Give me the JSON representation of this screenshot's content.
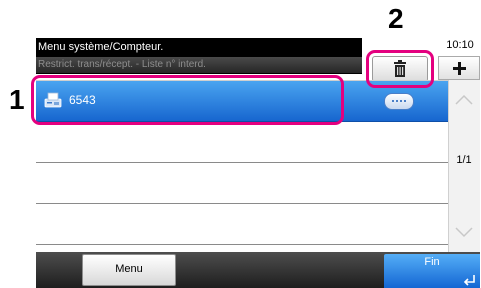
{
  "header": {
    "breadcrumb_line1": "Menu système/Compteur.",
    "breadcrumb_line2": "Restrict. trans/récept. - Liste n° interd.",
    "clock": "10:10"
  },
  "toolbar": {
    "delete_icon": "trash-icon",
    "add_icon": "plus-icon"
  },
  "list": {
    "rows": [
      {
        "name": "6543",
        "icon": "fax-icon",
        "selected": true
      },
      {
        "name": ""
      },
      {
        "name": ""
      },
      {
        "name": ""
      }
    ]
  },
  "pager": {
    "page_indicator": "1/1"
  },
  "footer": {
    "menu_label": "Menu",
    "fin_label": "Fin"
  },
  "callouts": {
    "one": "1",
    "two": "2"
  },
  "colors": {
    "accent_blue": "#1a6fd6",
    "callout_magenta": "#e4007f"
  }
}
